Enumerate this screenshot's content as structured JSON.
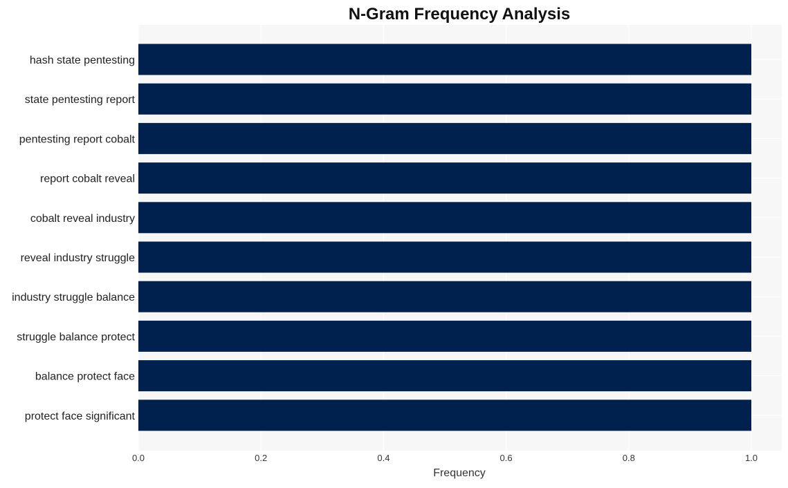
{
  "chart_data": {
    "type": "bar",
    "orientation": "horizontal",
    "title": "N-Gram Frequency Analysis",
    "xlabel": "Frequency",
    "ylabel": "",
    "categories": [
      "hash state pentesting",
      "state pentesting report",
      "pentesting report cobalt",
      "report cobalt reveal",
      "cobalt reveal industry",
      "reveal industry struggle",
      "industry struggle balance",
      "struggle balance protect",
      "balance protect face",
      "protect face significant"
    ],
    "values": [
      1,
      1,
      1,
      1,
      1,
      1,
      1,
      1,
      1,
      1
    ],
    "xlim": [
      0,
      1.05
    ],
    "xticks": [
      0.0,
      0.2,
      0.4,
      0.6,
      0.8,
      1.0
    ],
    "xtick_labels": [
      "0.0",
      "0.2",
      "0.4",
      "0.6",
      "0.8",
      "1.0"
    ],
    "grid": true,
    "legend": "none",
    "colors": {
      "bar": "#00204e",
      "plot_bg": "#f7f7f7",
      "grid": "#ffffff",
      "text": "#222222"
    }
  }
}
